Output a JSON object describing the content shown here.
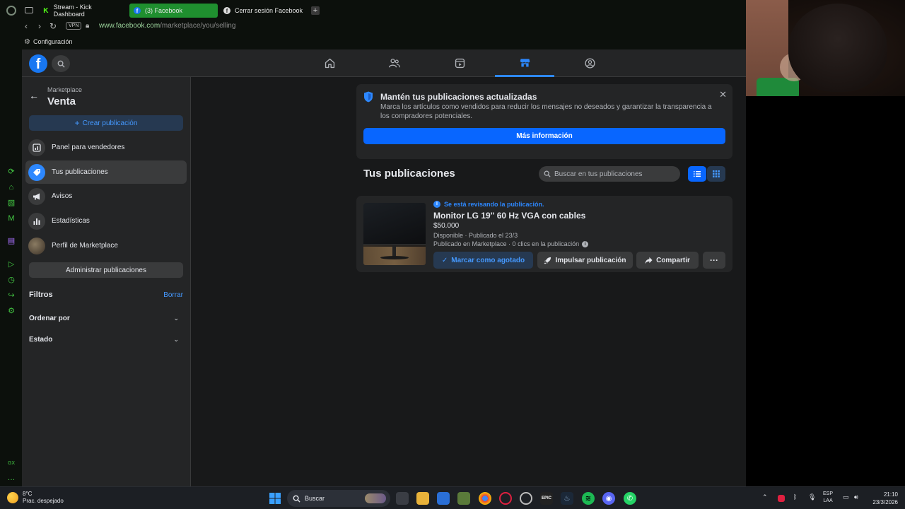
{
  "browser": {
    "tabs": [
      {
        "label": "Stream - Kick Dashboard",
        "favicon": "kick-icon"
      },
      {
        "label": "(3) Facebook",
        "favicon": "facebook-icon",
        "active": true
      },
      {
        "label": "Cerrar sesión Facebook",
        "favicon": "facebook-icon"
      }
    ],
    "url_domain": "www.facebook.com",
    "url_path": "/marketplace/you/selling",
    "vpn_label": "VPN",
    "bookmark_label": "Configuración"
  },
  "fb_nav": {
    "items": [
      "home-icon",
      "friends-icon",
      "watch-icon",
      "marketplace-icon",
      "groups-icon"
    ],
    "active": "marketplace-icon"
  },
  "sidebar": {
    "crumb": "Marketplace",
    "title": "Venta",
    "create_label": "Crear publicación",
    "items": [
      {
        "label": "Panel para vendedores",
        "icon": "dashboard-icon"
      },
      {
        "label": "Tus publicaciones",
        "icon": "tag-icon",
        "active": true
      },
      {
        "label": "Avisos",
        "icon": "megaphone-icon"
      },
      {
        "label": "Estadísticas",
        "icon": "stats-icon"
      },
      {
        "label": "Perfil de Marketplace",
        "icon": "avatar"
      }
    ],
    "manage_label": "Administrar publicaciones",
    "filters_title": "Filtros",
    "filters_clear": "Borrar",
    "filter_rows": [
      "Ordenar por",
      "Estado"
    ]
  },
  "notice": {
    "title": "Mantén tus publicaciones actualizadas",
    "body": "Marca los artículos como vendidos para reducir los mensajes no deseados y garantizar la transparencia a los compradores potenciales.",
    "button": "Más información"
  },
  "publications": {
    "title": "Tus publicaciones",
    "search_placeholder": "Buscar en tus publicaciones"
  },
  "listing": {
    "review_status": "Se está revisando la publicación.",
    "title": "Monitor LG 19\" 60 Hz VGA con cables",
    "price": "$50.000",
    "meta": "Disponible · Publicado el 23/3",
    "meta2": "Publicado en Marketplace · 0 clics en la publicación",
    "btn_sold": "Marcar como agotado",
    "btn_boost": "Impulsar publicación",
    "btn_share": "Compartir",
    "btn_more": "···"
  },
  "taskbar": {
    "temp": "8°C",
    "weather": "Prac. despejado",
    "search": "Buscar",
    "lang1": "ESP",
    "lang2": "LAA",
    "time": "21:10",
    "date": "23/3/2026"
  },
  "colors": {
    "accent": "#0866ff",
    "fb_blue": "#1877f2",
    "surface": "#242526",
    "bg": "#18191a"
  }
}
